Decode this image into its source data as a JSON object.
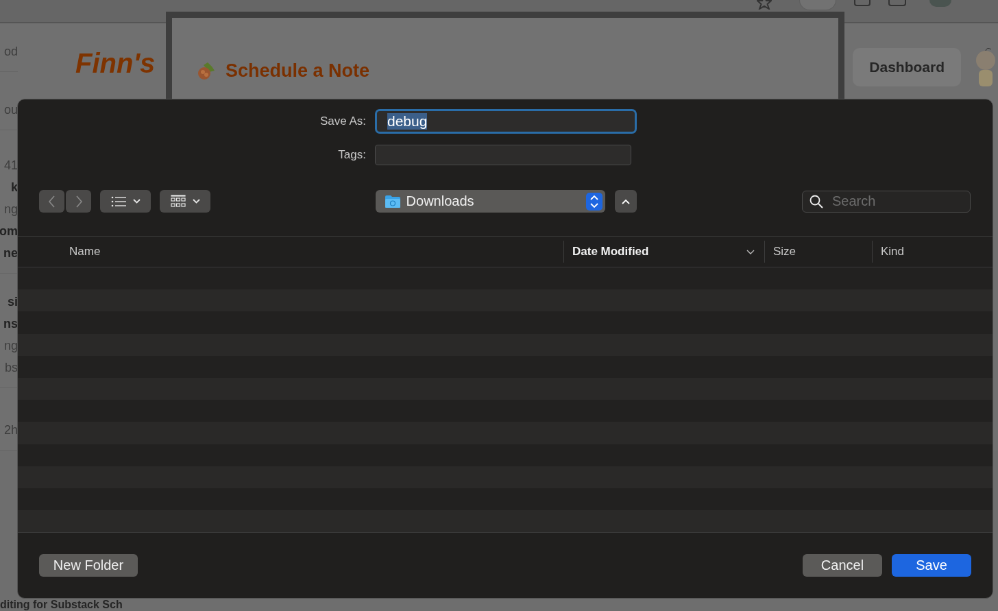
{
  "page": {
    "logo": "Finn's",
    "dashboard_button": "Dashboard",
    "side_groups": [
      [
        {
          "text": "od",
          "bold": false
        }
      ],
      [
        {
          "text": "ou",
          "bold": false
        }
      ],
      [
        {
          "text": "41",
          "bold": false
        },
        {
          "text": "k",
          "bold": true
        },
        {
          "text": "ng",
          "bold": false
        },
        {
          "text": "om",
          "bold": true
        },
        {
          "text": "ne",
          "bold": true
        }
      ],
      [
        {
          "text": "si",
          "bold": true
        },
        {
          "text": "ns",
          "bold": true
        },
        {
          "text": "ng",
          "bold": false
        },
        {
          "text": "bs",
          "bold": false
        }
      ],
      [
        {
          "text": "2h",
          "bold": false
        }
      ]
    ],
    "bottom_fragment": "diting for Substack Sch"
  },
  "schedule_panel": {
    "title": "Schedule a Note"
  },
  "save_dialog": {
    "save_as_label": "Save As:",
    "save_as_value": "debug",
    "value_selected": true,
    "tags_label": "Tags:",
    "location": "Downloads",
    "search": {
      "placeholder": "Search"
    },
    "columns": [
      {
        "label": "Name",
        "sorted": false
      },
      {
        "label": "Date Modified",
        "sorted": true
      },
      {
        "label": "Size",
        "sorted": false
      },
      {
        "label": "Kind",
        "sorted": false
      }
    ],
    "buttons": [
      {
        "label": "New Folder",
        "kind": "secondary"
      },
      {
        "label": "Cancel",
        "kind": "secondary"
      },
      {
        "label": "Save",
        "kind": "default"
      }
    ]
  }
}
